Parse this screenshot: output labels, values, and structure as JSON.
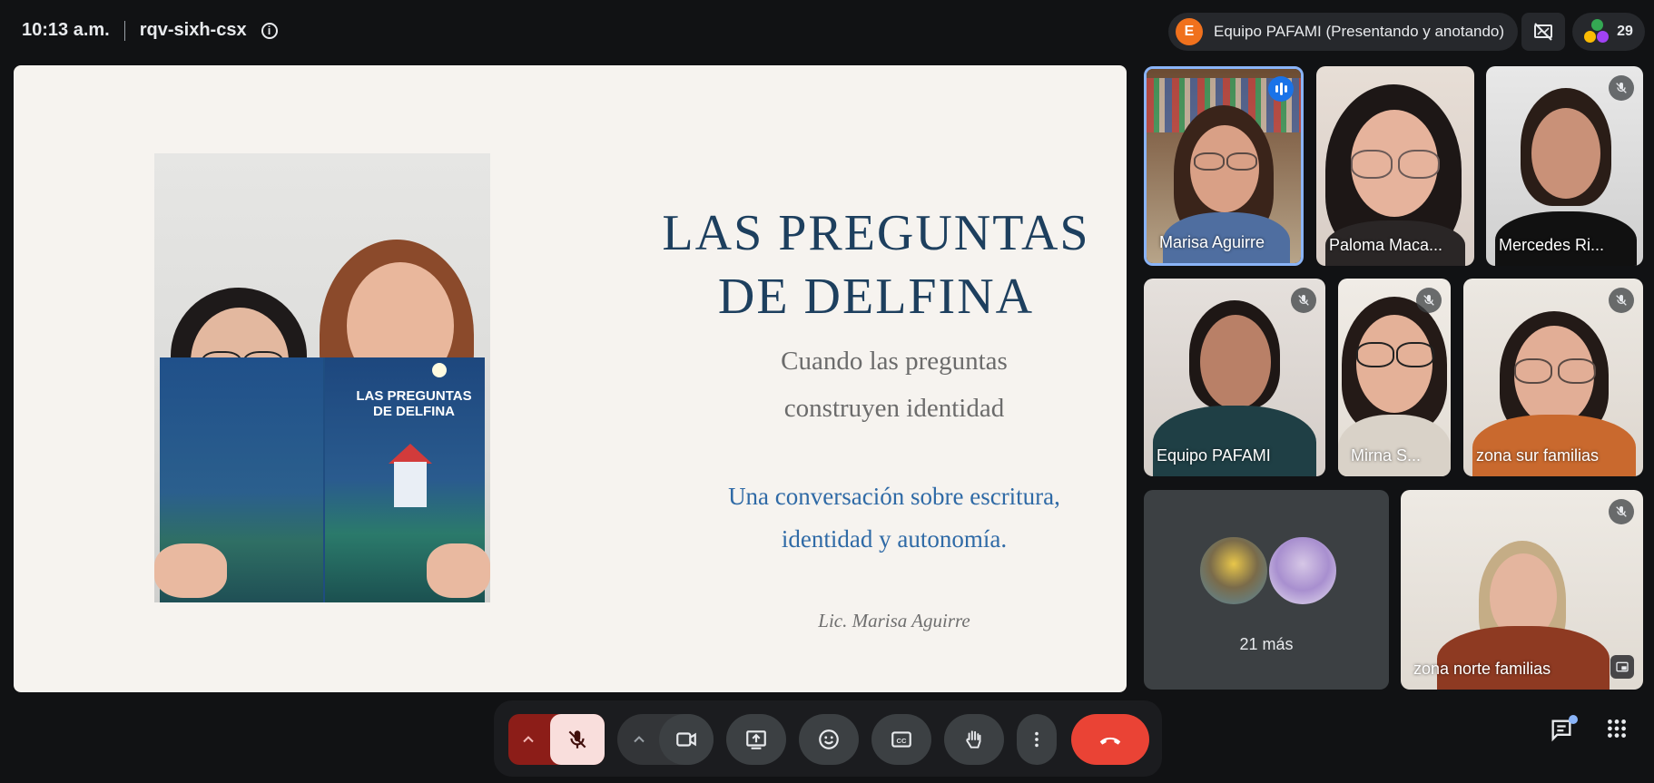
{
  "topbar": {
    "time": "10:13 a.m.",
    "meeting_code": "rqv-sixh-csx",
    "presenter_initial": "E",
    "presenter_label": "Equipo PAFAMI (Presentando y anotando)",
    "participant_count": "29"
  },
  "slide": {
    "title_line1": "LAS PREGUNTAS",
    "title_line2": "DE DELFINA",
    "subtitle_line1": "Cuando las preguntas",
    "subtitle_line2": "construyen identidad",
    "conversation_line1": "Una conversación sobre escritura,",
    "conversation_line2": "identidad y autonomía.",
    "author": "Lic. Marisa Aguirre",
    "book_title_line1": "LAS PREGUNTAS",
    "book_title_line2": "DE DELFINA"
  },
  "participants": [
    {
      "name": "Marisa Aguirre",
      "speaking": true
    },
    {
      "name": "Paloma Maca...",
      "speaking": false
    },
    {
      "name": "Mercedes Ri...",
      "muted": true
    },
    {
      "name": "Equipo PAFAMI",
      "muted": true
    },
    {
      "name": "Mirna S...",
      "muted": true
    },
    {
      "name": "zona sur familias",
      "muted": true
    },
    {
      "name": "zona norte familias",
      "muted": true
    }
  ],
  "more_tile": {
    "label": "21 más"
  },
  "colors": {
    "background": "#111214",
    "end_call": "#ea4335",
    "mic_off": "#8c1d18",
    "speaking_indicator": "#1a73e8",
    "slide_title": "#1d3f5e",
    "slide_conversation": "#2f6aa6"
  },
  "controls": {
    "icons": [
      "caret-up-icon",
      "mic-off-icon",
      "caret-up-icon",
      "camera-icon",
      "present-screen-icon",
      "emoji-icon",
      "captions-icon",
      "raise-hand-icon",
      "more-vert-icon",
      "end-call-icon"
    ],
    "right_icons": [
      "chat-icon",
      "activities-icon"
    ]
  }
}
